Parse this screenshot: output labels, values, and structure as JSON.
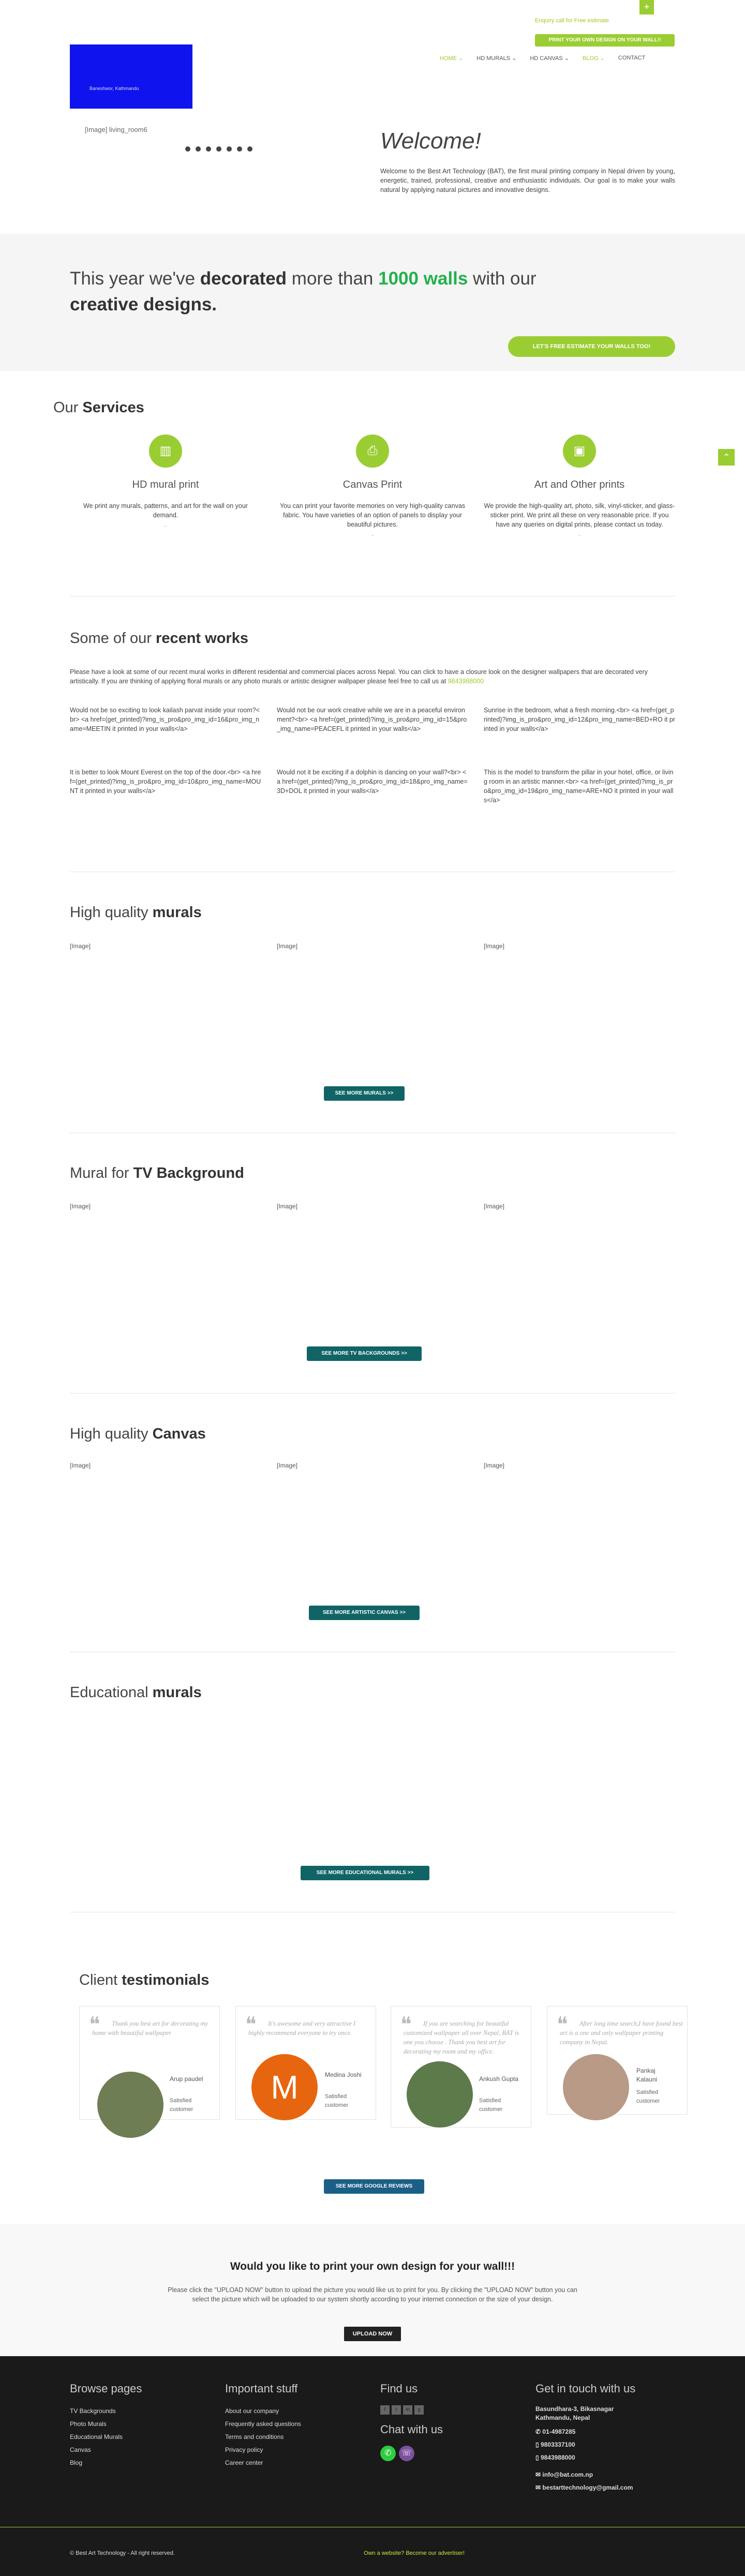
{
  "header": {
    "call": "Enquiry call for Free estimate",
    "plus": "+",
    "print_now": "PRINT YOUR OWN DESIGN ON YOUR WALL!!",
    "logo_tagline": "Baneshwor, Kathmandu",
    "nav": [
      "HOME",
      "HD MURALS",
      "HD CANVAS",
      "BLOG",
      "CONTACT"
    ]
  },
  "hero": {
    "image_alt": "[Image] living_room6",
    "welcome": "Welcome!",
    "text": "Welcome to the Best Art Technology (BAT), the first mural printing company in Nepal driven by young, energetic, trained, professional, creative and enthusiastic individuals. Our goal is to make your walls natural by applying natural pictures and innovative designs."
  },
  "band": {
    "t1": "This year we've ",
    "t2": "decorated",
    "t3": " more than ",
    "t4": "1000 walls",
    "t5": " with our ",
    "t6": "creative designs.",
    "button": "LET'S FREE ESTIMATE YOUR WALLS TOO!"
  },
  "services": {
    "title_a": "Our ",
    "title_b": "Services",
    "items": [
      {
        "icon": "picture-icon",
        "title": "HD mural print",
        "desc": "We print any murals, patterns, and art for the wall on your demand.",
        "dash": "-"
      },
      {
        "icon": "printer-icon",
        "title": "Canvas Print",
        "desc": "You can print your favorite memories on very high-quality canvas fabric. You have varieties of an option of panels to display your beautiful pictures.",
        "dash": "-"
      },
      {
        "icon": "image-icon",
        "title": "Art and Other prints",
        "desc": "We provide the high-quality art, photo, silk, vinyl-sticker, and glass-sticker print. We print all these on very reasonable price. If you have any queries on digital prints, please contact us today.",
        "dash": "-"
      }
    ]
  },
  "recent": {
    "title_a": "Some of our ",
    "title_b": "recent works",
    "intro": "Please have a look at some of our recent mural works in different residential and commercial places across Nepal. You can click to have a closure look on the designer wallpapers that are decorated very artistically. If you are thinking of applying floral murals or any photo murals or artistic designer wallpaper please feel free to call us at ",
    "phone": "9843988000",
    "items": [
      "Would not be so exciting to look kailash parvat inside your room?<br> <a href=(get_printed)?img_is_pro&pro_img_id=16&pro_img_name=MEETIN it printed in your walls</a>",
      "Would not be our work creative while we are in a peaceful environment?<br> <a href=(get_printed)?img_is_pro&pro_img_id=15&pro_img_name=PEACEFL it printed in your walls</a>",
      "Sunrise in the bedroom, what a fresh morning.<br> <a href=(get_printed)?img_is_pro&pro_img_id=12&pro_img_name=BED+RO it printed in your walls</a>",
      "It is better to look Mount Everest on the top of the door.<br> <a href=(get_printed)?img_is_pro&pro_img_id=10&pro_img_name=MOUNT it printed in your walls</a>",
      "Would not it be exciting if a dolphin is dancing on your wall?<br> <a href=(get_printed)?img_is_pro&pro_img_id=18&pro_img_name=3D+DOL it printed in your walls</a>",
      "This is the model to transform the pillar in your hotel, office, or living room in an artistic manner.<br> <a href=(get_printed)?img_is_pro&pro_img_id=19&pro_img_name=ARE+NO it printed in your walls</a>"
    ]
  },
  "murals": {
    "title_a": "High quality ",
    "title_b": "murals",
    "img": "[Image]",
    "button": "SEE MORE MURALS >>"
  },
  "tv": {
    "title_a": "Mural for ",
    "title_b": "TV Background",
    "img": "[Image]",
    "button": "SEE MORE TV BACKGROUNDS >>"
  },
  "canvas": {
    "title_a": "High quality ",
    "title_b": "Canvas",
    "img": "[Image]",
    "button": "SEE MORE ARTISTIC CANVAS >>"
  },
  "edu": {
    "title_a": "Educational ",
    "title_b": "murals",
    "button": "SEE MORE EDUCATIONAL MURALS >>"
  },
  "testimonials": {
    "title_a": "Client ",
    "title_b": "testimonials",
    "status": "Satisfied customer",
    "items": [
      {
        "quote": "Thank you best art for decorating my home with beautiful wallpaper",
        "name": "Arup paudel",
        "avatar_color": "#6f7d54"
      },
      {
        "quote": "It's awesome and very attractive I highly recommend everyone to try once.",
        "name": "Medina Joshi",
        "avatar_color": "#e8650f",
        "initial": "M"
      },
      {
        "quote": "If you are searching for beautiful customized wallpaper all over Nepal, BAT is one you choose . Thank you best art for decorating my room and my office.",
        "name": "Ankush Gupta",
        "avatar_color": "#5c7a4a"
      },
      {
        "quote": "After long time search,I have found best art is a one and only wallpaper printing company in Nepal.",
        "name": "Pankaj Kalauni",
        "avatar_color": "#b89a86"
      }
    ],
    "button": "SEE MORE GOOGLE REVIEWS"
  },
  "cta": {
    "heading": "Would you like to print your own design for your wall!!!",
    "text": "Please click the \"UPLOAD NOW\" button to upload the picture you would like us to print for you. By clicking the \"UPLOAD NOW\" button you can select the picture which will be uploaded to our system shortly according to your internet connection or the size of your design.",
    "button": "UPLOAD NOW"
  },
  "footer": {
    "browse_title": "Browse pages",
    "browse": [
      "TV Backgrounds",
      "Photo Murals",
      "Educational Murals",
      "Canvas",
      "Blog"
    ],
    "important_title": "Important stuff",
    "important": [
      "About our company",
      "Frequently asked questions",
      "Terms and conditions",
      "Privacy policy",
      "Career center"
    ],
    "find_title": "Find us",
    "social": [
      "f",
      "t",
      "in",
      "g"
    ],
    "chat_title": "Chat with us",
    "touch_title": "Get in touch with us",
    "address1": "Basundhara-3, Bikasnagar",
    "address2": "Kathmandu, Nepal",
    "phones": [
      "01-4987285",
      "9803337100",
      "9843988000"
    ],
    "emails": [
      "info@bat.com.np",
      "bestarttechnology@gmail.com"
    ],
    "copyright": "© Best Art Technology - All right reserved.",
    "advertise": "Own a website? Become our advertiser!"
  }
}
